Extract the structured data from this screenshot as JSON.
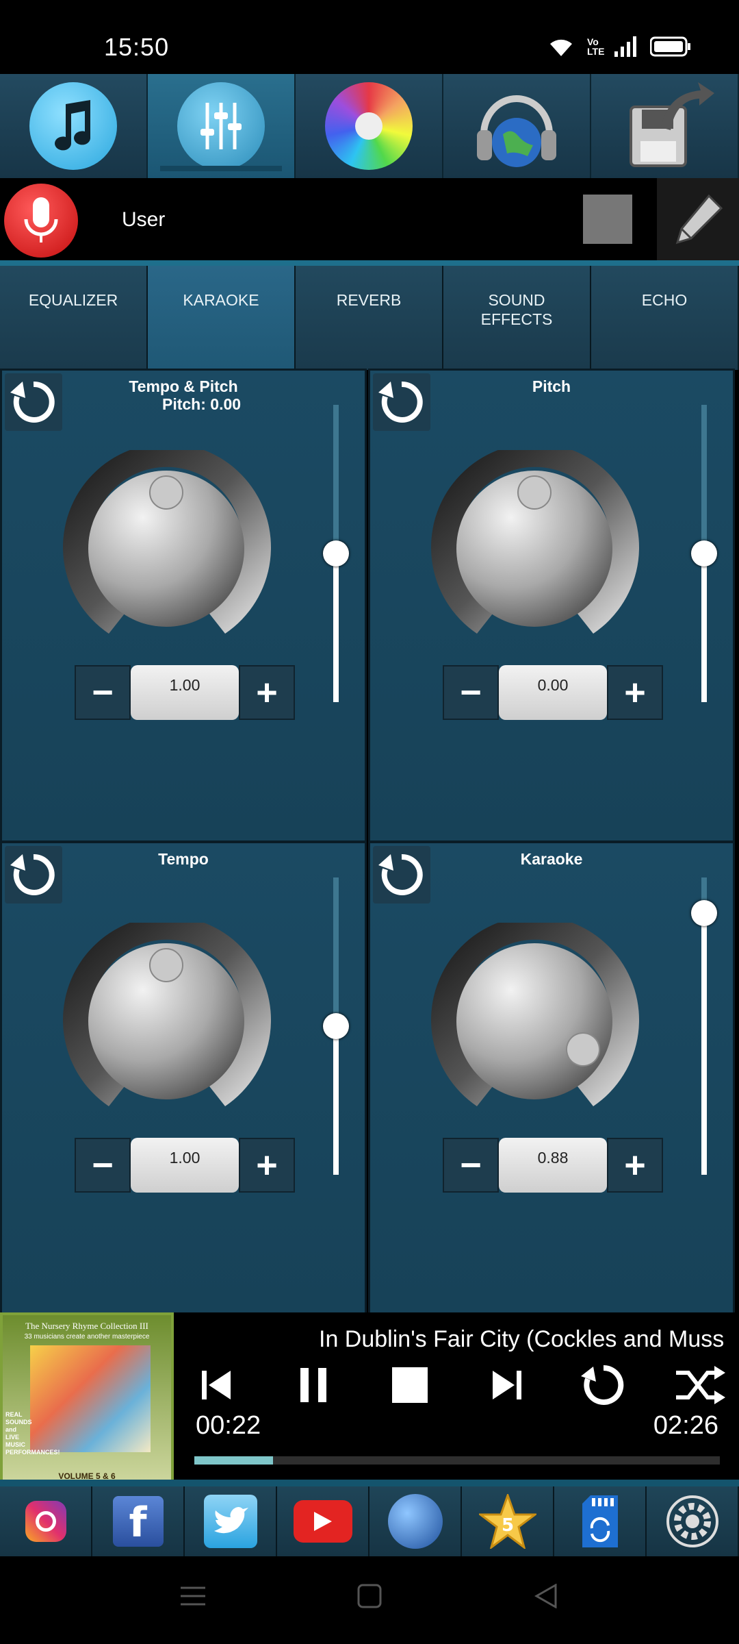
{
  "status": {
    "time": "15:50",
    "network_label": "Vo LTE"
  },
  "topbar": {
    "items": [
      {
        "name": "music-icon"
      },
      {
        "name": "mixer-icon",
        "active": true
      },
      {
        "name": "color-aperture-icon"
      },
      {
        "name": "headphones-globe-icon"
      },
      {
        "name": "save-share-icon"
      }
    ]
  },
  "userbar": {
    "username": "User",
    "swatch_color": "#777777"
  },
  "tabs": [
    {
      "label": "EQUALIZER"
    },
    {
      "label": "KARAOKE",
      "active": true
    },
    {
      "label": "REVERB"
    },
    {
      "label": "SOUND\nEFFECTS"
    },
    {
      "label": "ECHO"
    }
  ],
  "panels": [
    {
      "title": "Tempo & Pitch",
      "subtitle": "Pitch:  0.00",
      "value": "1.00",
      "slider_level": 0.5,
      "knob_angle_deg": 0
    },
    {
      "title": "Pitch",
      "subtitle": "",
      "value": "0.00",
      "slider_level": 0.5,
      "knob_angle_deg": 0
    },
    {
      "title": "Tempo",
      "subtitle": "",
      "value": "1.00",
      "slider_level": 0.5,
      "knob_angle_deg": 0
    },
    {
      "title": "Karaoke",
      "subtitle": "",
      "value": "0.88",
      "slider_level": 0.88,
      "knob_angle_deg": 120
    }
  ],
  "stepper": {
    "minus": "−",
    "plus": "+"
  },
  "player": {
    "song_title": "In Dublin's Fair City (Cockles and Muss",
    "elapsed": "00:22",
    "total": "02:26",
    "progress": 0.15,
    "cover": {
      "title": "The Nursery Rhyme Collection III",
      "subtitle": "33 musicians create another masterpiece",
      "side_text": "REAL SOUNDS and LIVE MUSIC PERFORMANCES!",
      "volume": "VOLUME 5 & 6"
    }
  },
  "bottombar": {
    "items": [
      {
        "name": "instagram-icon"
      },
      {
        "name": "facebook-icon"
      },
      {
        "name": "twitter-icon"
      },
      {
        "name": "youtube-icon"
      },
      {
        "name": "website-globe-icon"
      },
      {
        "name": "rate-star-icon"
      },
      {
        "name": "sd-card-sync-icon"
      },
      {
        "name": "settings-gear-icon"
      }
    ]
  }
}
